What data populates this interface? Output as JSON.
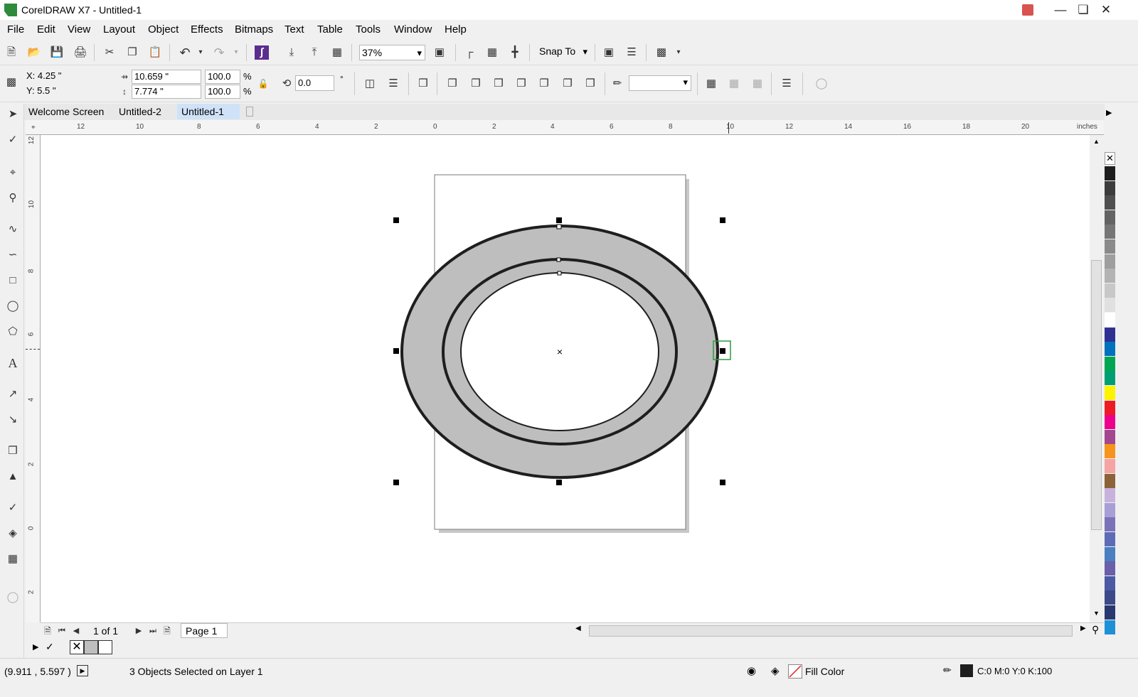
{
  "window": {
    "title": "CorelDRAW X7 - Untitled-1"
  },
  "menu": [
    "File",
    "Edit",
    "View",
    "Layout",
    "Object",
    "Effects",
    "Bitmaps",
    "Text",
    "Table",
    "Tools",
    "Window",
    "Help"
  ],
  "toolbar": {
    "zoom": "37%",
    "snap_to": "Snap To"
  },
  "property_bar": {
    "x": "X: 4.25 \"",
    "y": "Y: 5.5 \"",
    "width": "10.659 \"",
    "height": "7.774 \"",
    "scale_w": "100.0",
    "scale_h": "100.0",
    "pct": "%",
    "angle": "0.0",
    "deg": "°"
  },
  "doc_tabs": [
    "Welcome Screen",
    "Untitled-2",
    "Untitled-1"
  ],
  "ruler": {
    "units": "inches",
    "h_ticks": [
      "12",
      "10",
      "8",
      "6",
      "4",
      "2",
      "0",
      "2",
      "4",
      "6",
      "8",
      "10",
      "12",
      "14",
      "16",
      "18",
      "20"
    ],
    "v_ticks": [
      "12",
      "10",
      "8",
      "6",
      "4",
      "2",
      "0",
      "2"
    ]
  },
  "page_nav": {
    "count": "1 of 1",
    "page_tab": "Page 1"
  },
  "status": {
    "coords": "(9.911 , 5.597 )",
    "selection": "3 Objects Selected on Layer 1",
    "fill": "Fill Color",
    "outline": "C:0 M:0 Y:0 K:100"
  },
  "colors": {
    "ring_fill": "#bebebe",
    "outline": "#1e1e1e",
    "selection_accent": "#2e9a3e"
  },
  "palette": [
    "#1e1e1e",
    "#3c3c3c",
    "#4f4f4f",
    "#636363",
    "#767676",
    "#8a8a8a",
    "#9e9e9e",
    "#b3b3b3",
    "#c8c8c8",
    "#e0e0e0",
    "#ffffff",
    "#2e3192",
    "#0071bc",
    "#00a651",
    "#009e73",
    "#fff200",
    "#ed1c24",
    "#ec008c",
    "#a3488f",
    "#f7941d",
    "#f5a3a3",
    "#8c6239",
    "#c7b2de",
    "#a89fd6",
    "#7b73b9",
    "#5f6bb4",
    "#4a7fc1",
    "#6a5fa8",
    "#4c5aa5",
    "#3c4a8a",
    "#2a3870",
    "#1e90d6"
  ],
  "icons": {
    "new": "new-document-icon",
    "open": "open-icon",
    "save": "save-icon",
    "print": "print-icon",
    "cut": "cut-icon",
    "copy": "copy-icon",
    "paste": "paste-icon",
    "undo": "undo-icon",
    "redo": "redo-icon"
  }
}
